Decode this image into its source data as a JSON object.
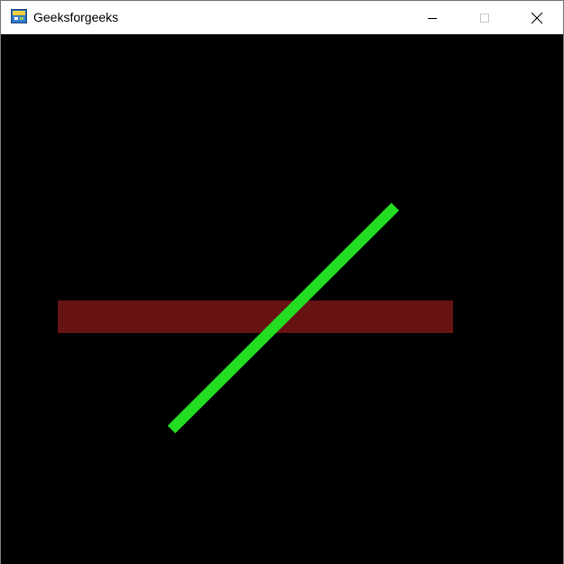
{
  "window": {
    "title": "Geeksforgeeks",
    "icon": "python-app-icon",
    "controls": {
      "minimize_icon": "minimize-icon",
      "maximize_icon": "maximize-icon",
      "close_icon": "close-icon"
    }
  },
  "canvas": {
    "background": "#000000",
    "shapes": [
      {
        "kind": "rectangle",
        "color": "#8b1a1a",
        "opacity": 0.75
      },
      {
        "kind": "line",
        "color": "#22dd22",
        "opacity": 1
      }
    ]
  }
}
